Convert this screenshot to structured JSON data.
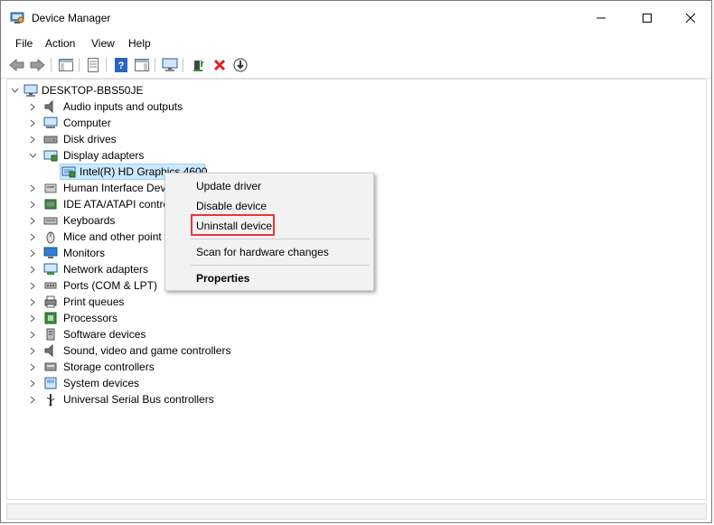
{
  "window": {
    "title": "Device Manager"
  },
  "menu": [
    "File",
    "Action",
    "View",
    "Help"
  ],
  "toolbar": {
    "buttons": [
      "back-arrow-icon",
      "forward-arrow-icon",
      "show-hide-console-tree-icon",
      "properties-icon",
      "help-icon",
      "action-pane-icon",
      "monitor-icon",
      "update-driver-icon",
      "uninstall-icon",
      "scan-download-icon"
    ]
  },
  "tree": {
    "root": "DESKTOP-BBS50JE",
    "categories": [
      {
        "label": "Audio inputs and outputs",
        "icon": "speaker-icon",
        "expanded": false
      },
      {
        "label": "Computer",
        "icon": "computer-icon",
        "expanded": false
      },
      {
        "label": "Disk drives",
        "icon": "disk-drive-icon",
        "expanded": false
      },
      {
        "label": "Display adapters",
        "icon": "display-adapter-icon",
        "expanded": true
      },
      {
        "label": "Human Interface Dev",
        "icon": "hid-icon",
        "expanded": false
      },
      {
        "label": "IDE ATA/ATAPI contro",
        "icon": "ide-controller-icon",
        "expanded": false
      },
      {
        "label": "Keyboards",
        "icon": "keyboard-icon",
        "expanded": false
      },
      {
        "label": "Mice and other point",
        "icon": "mouse-icon",
        "expanded": false
      },
      {
        "label": "Monitors",
        "icon": "monitor-icon",
        "expanded": false
      },
      {
        "label": "Network adapters",
        "icon": "network-adapter-icon",
        "expanded": false
      },
      {
        "label": "Ports (COM & LPT)",
        "icon": "port-icon",
        "expanded": false
      },
      {
        "label": "Print queues",
        "icon": "printer-icon",
        "expanded": false
      },
      {
        "label": "Processors",
        "icon": "processor-icon",
        "expanded": false
      },
      {
        "label": "Software devices",
        "icon": "software-device-icon",
        "expanded": false
      },
      {
        "label": "Sound, video and game controllers",
        "icon": "speaker-icon",
        "expanded": false
      },
      {
        "label": "Storage controllers",
        "icon": "storage-controller-icon",
        "expanded": false
      },
      {
        "label": "System devices",
        "icon": "system-device-icon",
        "expanded": false
      },
      {
        "label": "Universal Serial Bus controllers",
        "icon": "usb-icon",
        "expanded": false
      }
    ],
    "selected_child": "Intel(R) HD Graphics 4600"
  },
  "context_menu": {
    "items": [
      "Update driver",
      "Disable device",
      "Uninstall device",
      "Scan for hardware changes",
      "Properties"
    ],
    "highlighted": "Uninstall device",
    "highlight_color": "#e53939"
  },
  "colors": {
    "selection_bg": "#cce8ff",
    "selection_border": "#99d1ff",
    "menu_bg": "#f2f2f2"
  }
}
